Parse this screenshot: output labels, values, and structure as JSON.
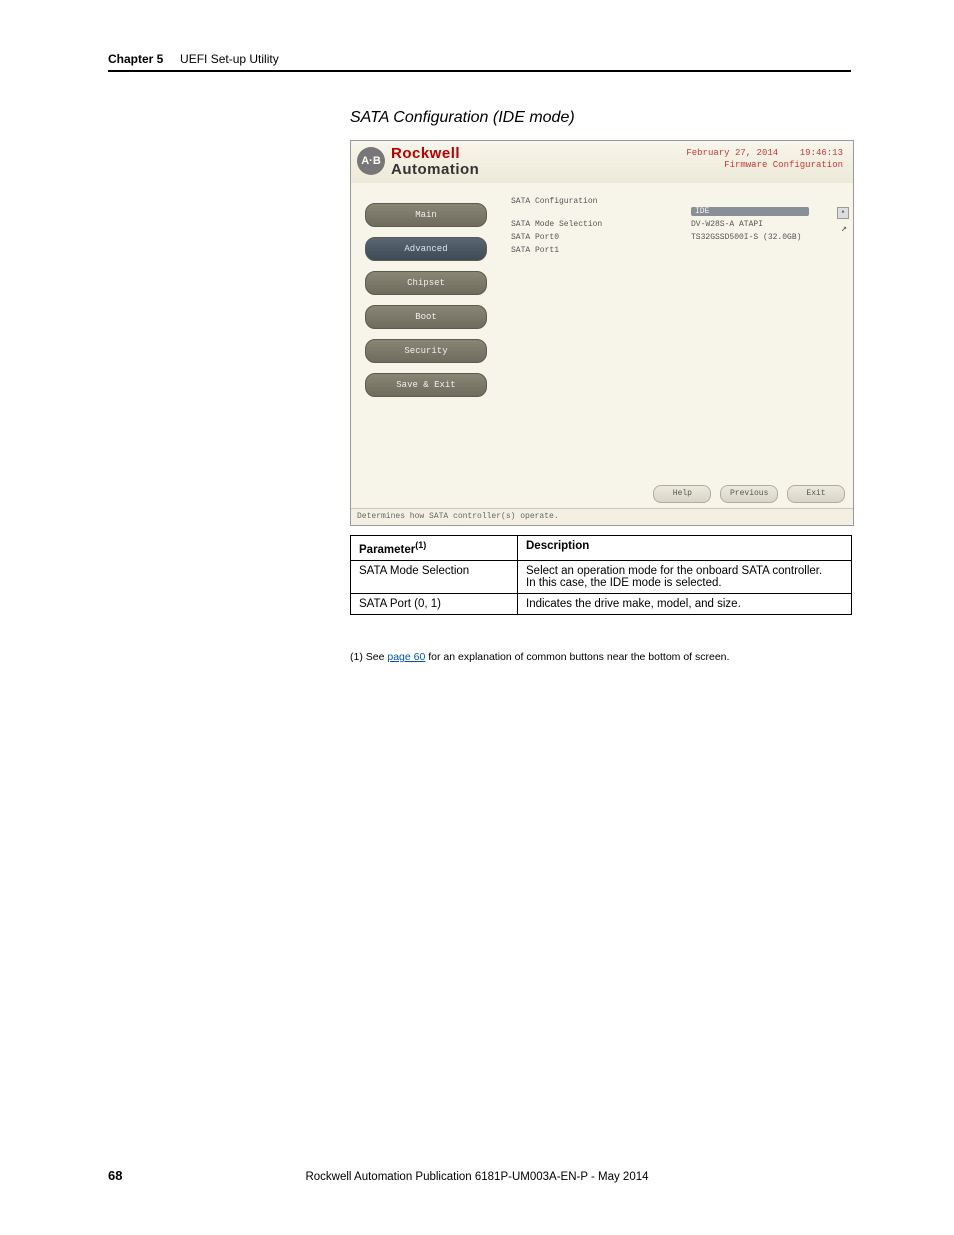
{
  "runhead": {
    "chapter": "Chapter 5",
    "title": "UEFI Set-up Utility"
  },
  "section_title": "SATA Configuration (IDE mode)",
  "bios": {
    "brand": {
      "logo_text": "A·B",
      "line1": "Rockwell",
      "line2": "Automation"
    },
    "header_right": {
      "date": "February 27, 2014",
      "time": "19:46:13",
      "subtitle": "Firmware Configuration"
    },
    "side_items": [
      "Main",
      "Advanced",
      "Chipset",
      "Boot",
      "Security",
      "Save & Exit"
    ],
    "side_active_index": 1,
    "content": {
      "heading": "SATA Configuration",
      "rows": [
        {
          "label": "SATA Mode Selection",
          "value": "IDE",
          "highlight": true
        },
        {
          "label": "SATA Port0",
          "value": "DV-W28S-A    ATAPI"
        },
        {
          "label": "SATA Port1",
          "value": "TS32GSSD500I-S (32.0GB)"
        }
      ]
    },
    "cursor_glyph": "↖",
    "actions": [
      "Help",
      "Previous",
      "Exit"
    ],
    "status": "Determines how SATA controller(s) operate."
  },
  "table": {
    "head": {
      "c1": "Parameter",
      "c1_sup": "(1)",
      "c2": "Description"
    },
    "rows": [
      {
        "c1": "SATA Mode Selection",
        "c2a": "Select an operation mode for the onboard SATA controller.",
        "c2b": "In this case, the IDE mode is selected."
      },
      {
        "c1": "SATA Port (0, 1)",
        "c2a": "Indicates the drive make, model, and size.",
        "c2b": ""
      }
    ]
  },
  "footnote": {
    "prefix": "(1)   See ",
    "link": "page 60",
    "suffix": " for an explanation of common buttons near the bottom of screen."
  },
  "footer": {
    "page": "68",
    "pub": "Rockwell Automation Publication 6181P-UM003A-EN-P - May 2014"
  }
}
